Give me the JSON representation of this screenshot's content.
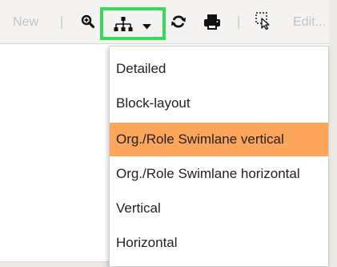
{
  "toolbar": {
    "new_label": "New",
    "sep1": "|",
    "sep2": "|",
    "sep3": "|",
    "edit_label": "Edit...",
    "icons": {
      "zoom": "zoom-in-icon",
      "hierarchy": "hierarchy-icon",
      "dropdown": "chevron-down-icon",
      "refresh": "refresh-icon",
      "print": "printer-icon",
      "select": "selection-cursor-icon"
    },
    "highlight_color": "#33dd55"
  },
  "layout_menu": {
    "items": [
      {
        "label": "Detailed",
        "selected": false
      },
      {
        "label": "Block-layout",
        "selected": false
      },
      {
        "label": "Org./Role Swimlane vertical",
        "selected": true
      },
      {
        "label": "Org./Role Swimlane horizontal",
        "selected": false
      },
      {
        "label": "Vertical",
        "selected": false
      },
      {
        "label": "Horizontal",
        "selected": false
      }
    ],
    "selected_color": "#fba65a"
  }
}
